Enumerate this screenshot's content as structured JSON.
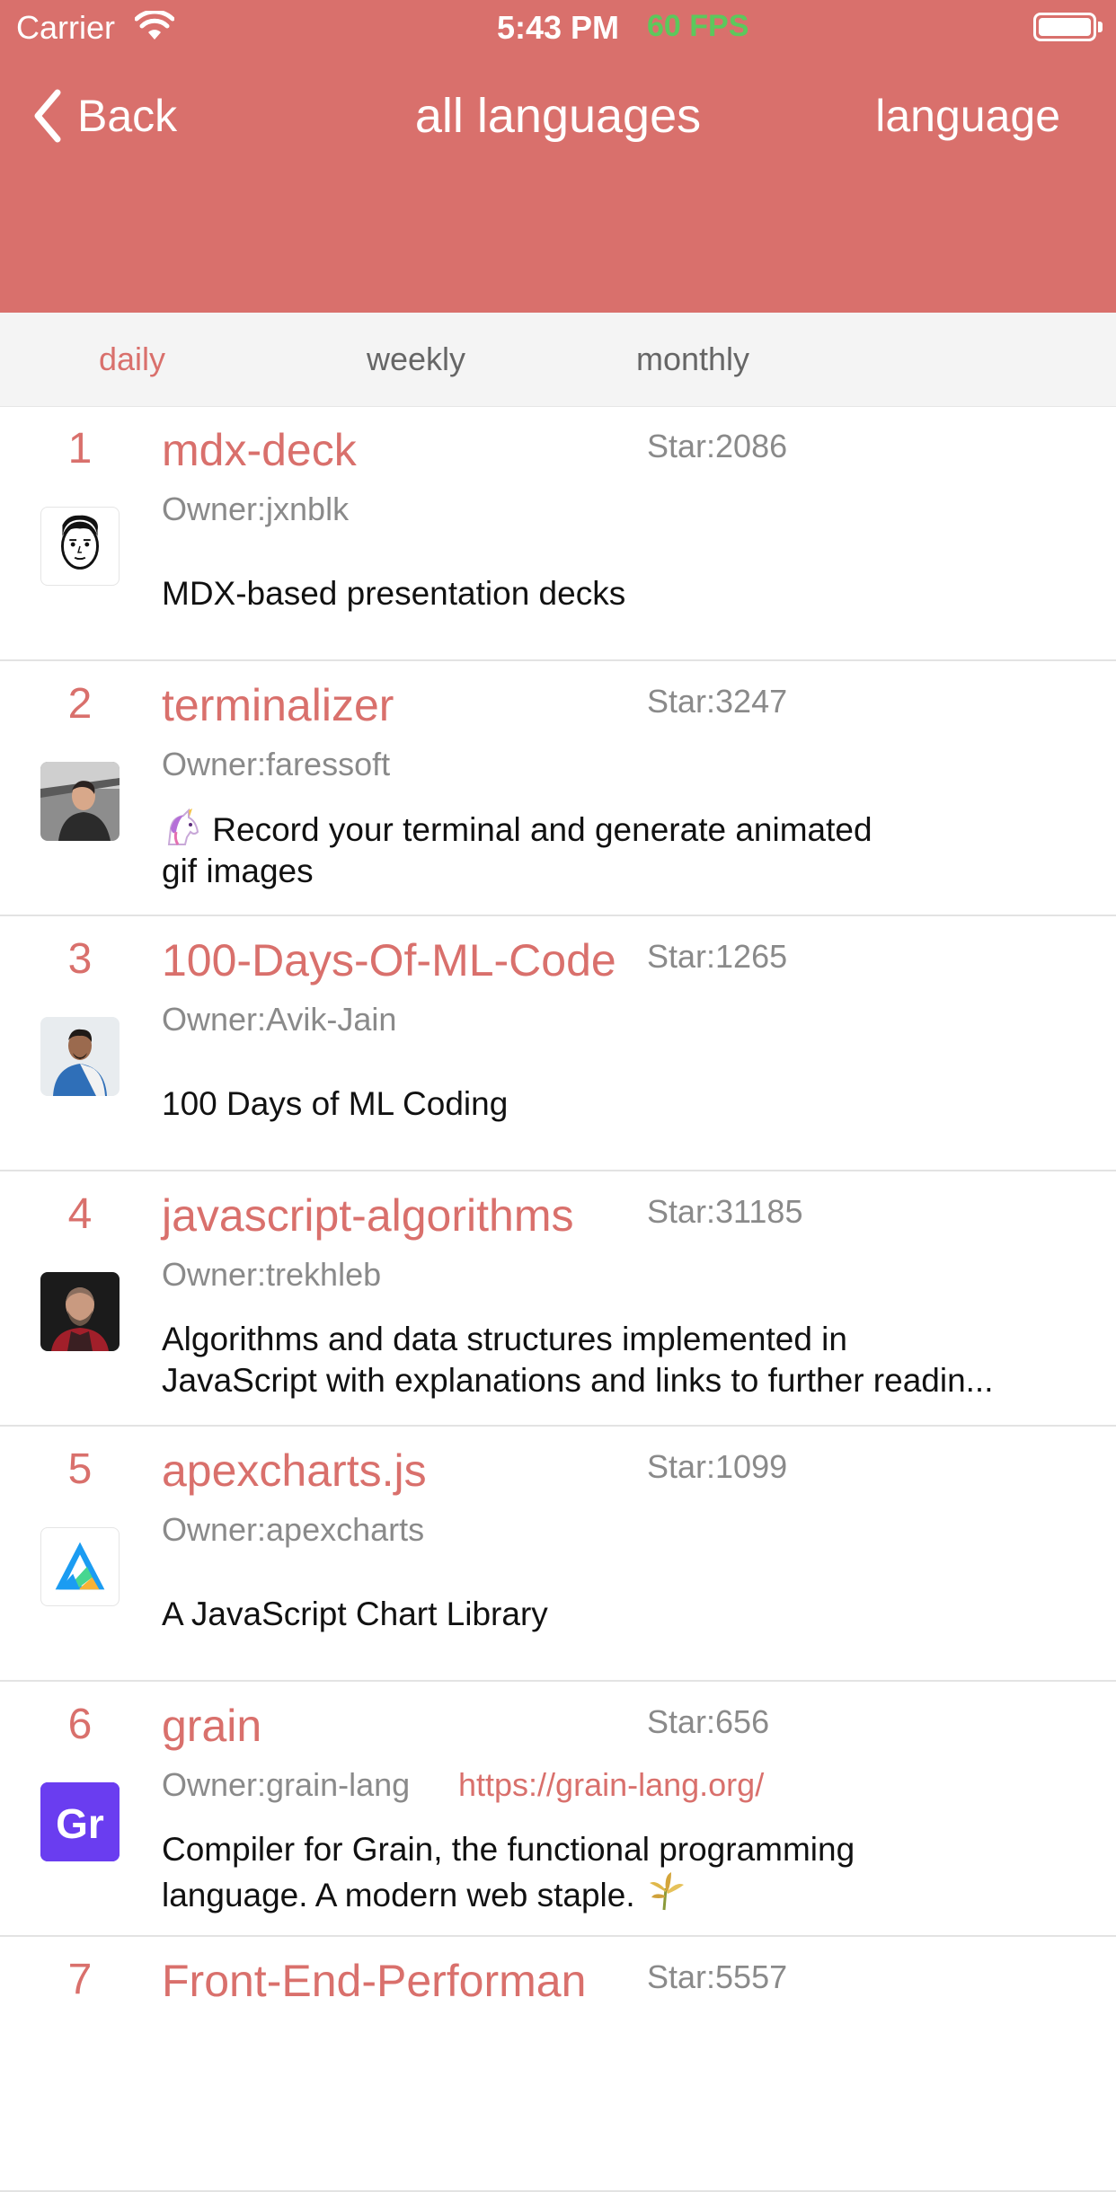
{
  "status": {
    "carrier": "Carrier",
    "time": "5:43 PM",
    "fps": "60 FPS",
    "fps_color": "#5cc85c"
  },
  "nav": {
    "back_label": "Back",
    "title": "all languages",
    "right_label": "language"
  },
  "colors": {
    "accent": "#d9706c",
    "tab_bg": "#f4f4f4"
  },
  "tabs": [
    {
      "label": "daily",
      "active": true
    },
    {
      "label": "weekly",
      "active": false
    },
    {
      "label": "monthly",
      "active": false
    }
  ],
  "repos": [
    {
      "rank": "1",
      "name": "mdx-deck",
      "stars": "Star:2086",
      "owner": "Owner:jxnblk",
      "homepage": "",
      "desc1": "MDX-based presentation decks",
      "desc2": "",
      "avatar": "cartoon-face-avatar"
    },
    {
      "rank": "2",
      "name": "terminalizer",
      "stars": "Star:3247",
      "owner": "Owner:faressoft",
      "homepage": "",
      "desc1": "Record your terminal and generate animated",
      "desc2": "gif images",
      "emoji": "unicorn-emoji",
      "avatar": "photo-avatar"
    },
    {
      "rank": "3",
      "name": "100-Days-Of-ML-Code",
      "stars": "Star:1265",
      "owner": "Owner:Avik-Jain",
      "homepage": "",
      "desc1": "100 Days of ML Coding",
      "desc2": "",
      "avatar": "photo-avatar"
    },
    {
      "rank": "4",
      "name": "javascript-algorithms",
      "stars": "Star:31185",
      "owner": "Owner:trekhleb",
      "homepage": "",
      "desc1": "Algorithms and data structures implemented in",
      "desc2": "JavaScript with explanations and links to further readin...",
      "avatar": "photo-avatar"
    },
    {
      "rank": "5",
      "name": "apexcharts.js",
      "stars": "Star:1099",
      "owner": "Owner:apexcharts",
      "homepage": "",
      "desc1": "A JavaScript Chart Library",
      "desc2": "",
      "avatar": "apexcharts-logo-avatar"
    },
    {
      "rank": "6",
      "name": "grain",
      "stars": "Star:656",
      "owner": "Owner:grain-lang",
      "homepage": "https://grain-lang.org/",
      "desc1": "Compiler for Grain, the functional programming",
      "desc2": "language. A modern web staple.",
      "emoji2": "sheaf-of-rice-emoji",
      "avatar": "grain-logo-avatar",
      "avatar_text": "Gr"
    },
    {
      "rank": "7",
      "name": "Front-End-Performan",
      "stars": "Star:5557",
      "owner": "",
      "homepage": "",
      "desc1": "",
      "desc2": ""
    }
  ]
}
